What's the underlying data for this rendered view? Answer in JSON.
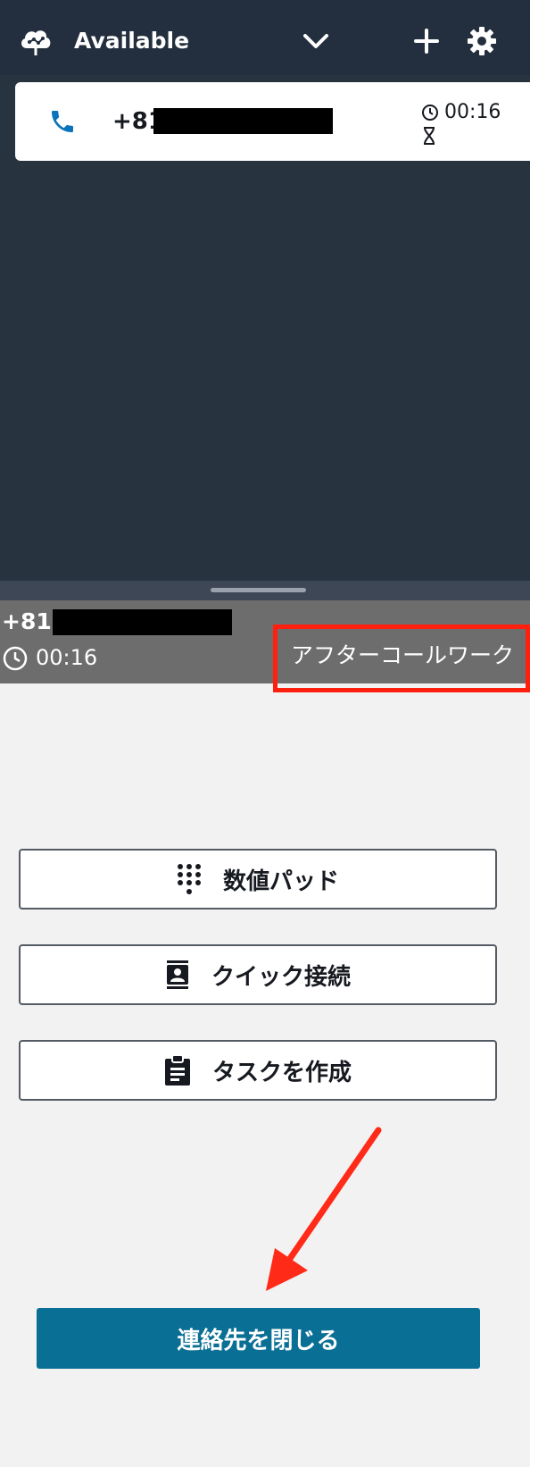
{
  "header": {
    "status_label": "Available",
    "icons": [
      "cloud-logo-icon",
      "chevron-down-icon",
      "plus-icon",
      "gear-icon"
    ]
  },
  "contact_card": {
    "phone_prefix": "+81",
    "timer": "00:16",
    "icons": [
      "phone-icon",
      "clock-icon",
      "hourglass-icon"
    ]
  },
  "contact_strip": {
    "phone_prefix": "+81",
    "timer": "00:16",
    "state_label": "アフターコールワーク"
  },
  "actions": {
    "number_pad_label": "数値パッド",
    "quick_connect_label": "クイック接続",
    "create_task_label": "タスクを作成"
  },
  "footer": {
    "close_contact_label": "連絡先を閉じる"
  },
  "colors": {
    "header_bg": "#232f3e",
    "primary_button": "#0a6f95",
    "highlight_annotation": "#ff1f0f"
  }
}
